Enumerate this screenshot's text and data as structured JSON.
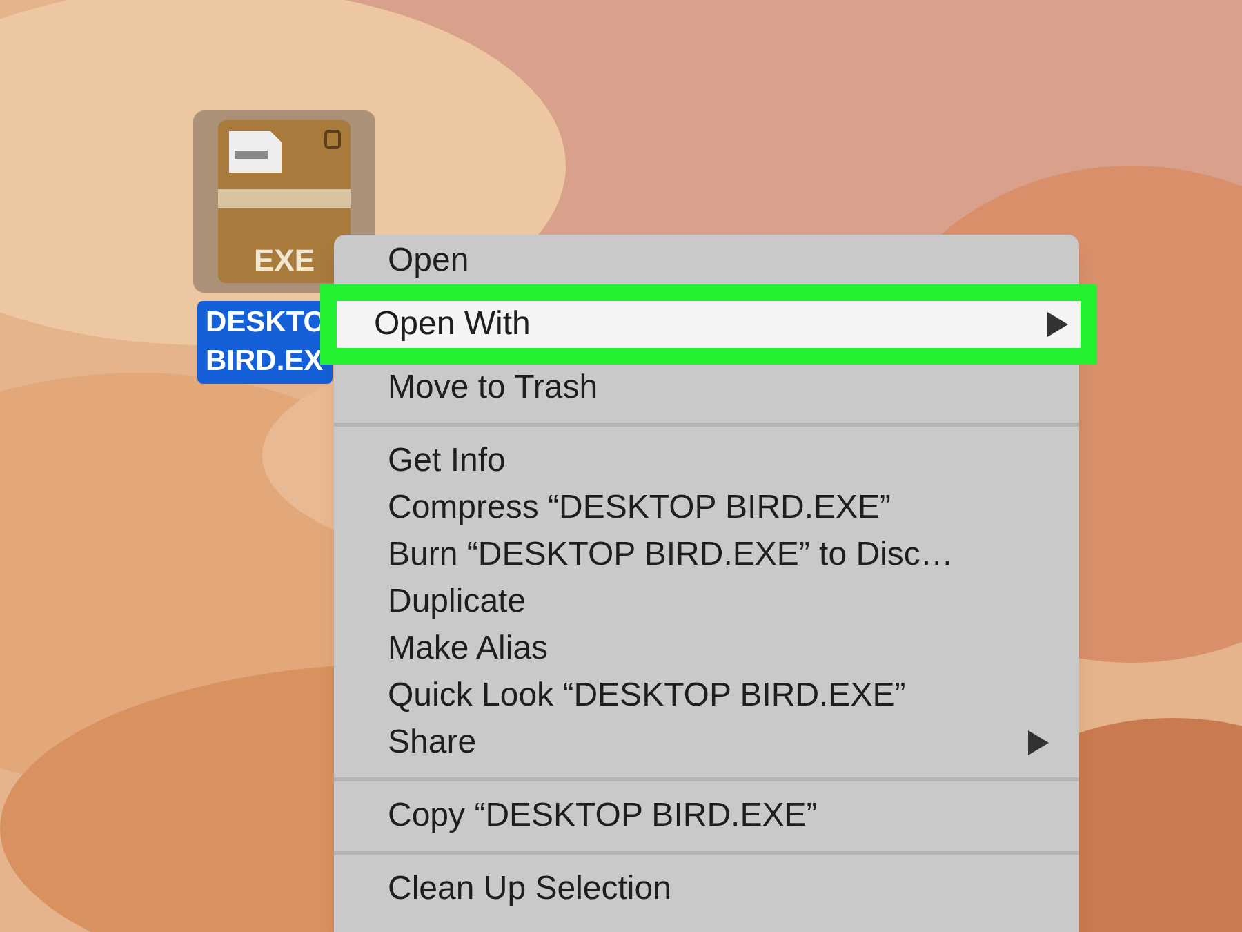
{
  "desktop_icon": {
    "kind": "file",
    "badge": "EXE",
    "selected": true,
    "label_lines": [
      "DESKTO",
      "BIRD.EX"
    ]
  },
  "context_menu": {
    "items": [
      {
        "kind": "item",
        "label": "Open",
        "selected": false,
        "submenu": false,
        "outlined": false
      },
      {
        "kind": "item",
        "label": "Open With",
        "selected": true,
        "submenu": true,
        "outlined": true
      },
      {
        "kind": "item",
        "label": "Move to Trash",
        "selected": false,
        "submenu": false,
        "outlined": false
      },
      {
        "kind": "separator"
      },
      {
        "kind": "item",
        "label": "Get Info",
        "selected": false,
        "submenu": false,
        "outlined": false
      },
      {
        "kind": "item",
        "label": "Compress “DESKTOP BIRD.EXE”",
        "selected": false,
        "submenu": false,
        "outlined": false
      },
      {
        "kind": "item",
        "label": "Burn “DESKTOP BIRD.EXE” to Disc…",
        "selected": false,
        "submenu": false,
        "outlined": false
      },
      {
        "kind": "item",
        "label": "Duplicate",
        "selected": false,
        "submenu": false,
        "outlined": false
      },
      {
        "kind": "item",
        "label": "Make Alias",
        "selected": false,
        "submenu": false,
        "outlined": false
      },
      {
        "kind": "item",
        "label": "Quick Look “DESKTOP BIRD.EXE”",
        "selected": false,
        "submenu": false,
        "outlined": false
      },
      {
        "kind": "item",
        "label": "Share",
        "selected": false,
        "submenu": true,
        "outlined": false
      },
      {
        "kind": "separator"
      },
      {
        "kind": "item",
        "label": "Copy “DESKTOP BIRD.EXE”",
        "selected": false,
        "submenu": false,
        "outlined": false
      },
      {
        "kind": "separator"
      },
      {
        "kind": "item",
        "label": "Clean Up Selection",
        "selected": false,
        "submenu": false,
        "outlined": false
      }
    ]
  }
}
